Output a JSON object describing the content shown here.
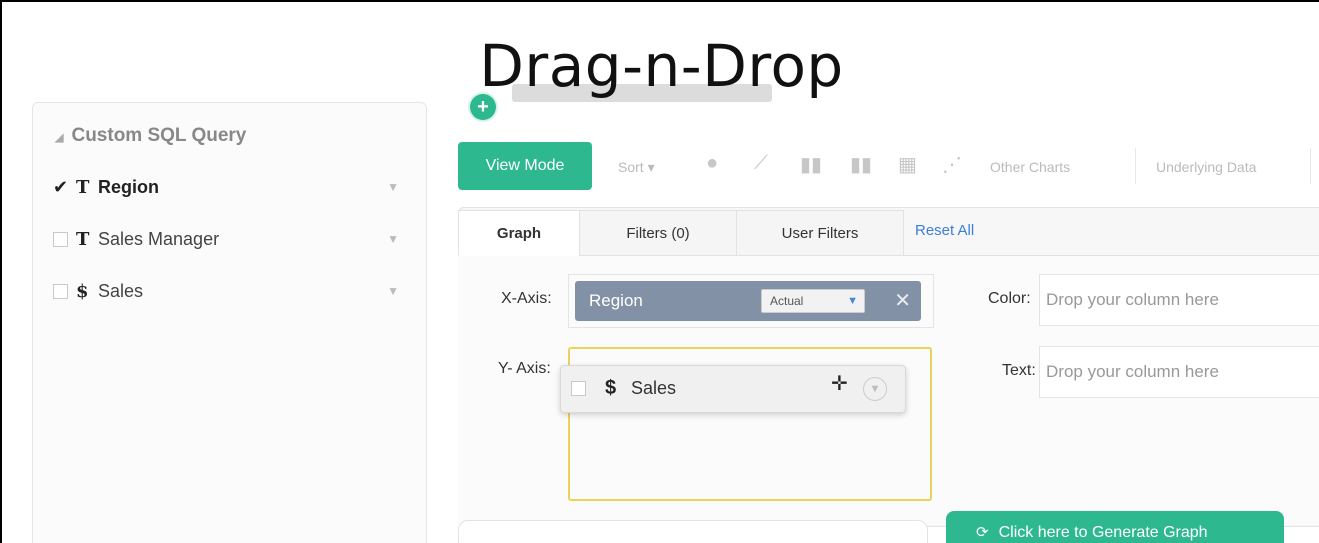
{
  "slide": {
    "title": "Drag-n-Drop"
  },
  "left_panel": {
    "header": "Custom SQL Query",
    "fields": [
      {
        "type_icon": "T",
        "label": "Region",
        "checked": true
      },
      {
        "type_icon": "T",
        "label": "Sales Manager",
        "checked": false
      },
      {
        "type_icon": "$",
        "label": "Sales",
        "checked": false
      }
    ]
  },
  "toolbar": {
    "view_mode": "View Mode",
    "sort": "Sort ▾",
    "other_charts": "Other Charts",
    "underlying_data": "Underlying Data"
  },
  "tabs": {
    "graph": "Graph",
    "filters": "Filters (0)",
    "user_filters": "User Filters",
    "reset_all": "Reset All"
  },
  "axes": {
    "x_label": "X-Axis:",
    "x_value": "Region",
    "x_aggregation": "Actual",
    "y_label": "Y- Axis:",
    "color_label": "Color:",
    "color_placeholder": "Drop your column here",
    "text_label": "Text:",
    "text_placeholder": "Drop your column here"
  },
  "drag_chip": {
    "icon": "$",
    "label": "Sales"
  },
  "generate_button": "Click here to Generate Graph"
}
